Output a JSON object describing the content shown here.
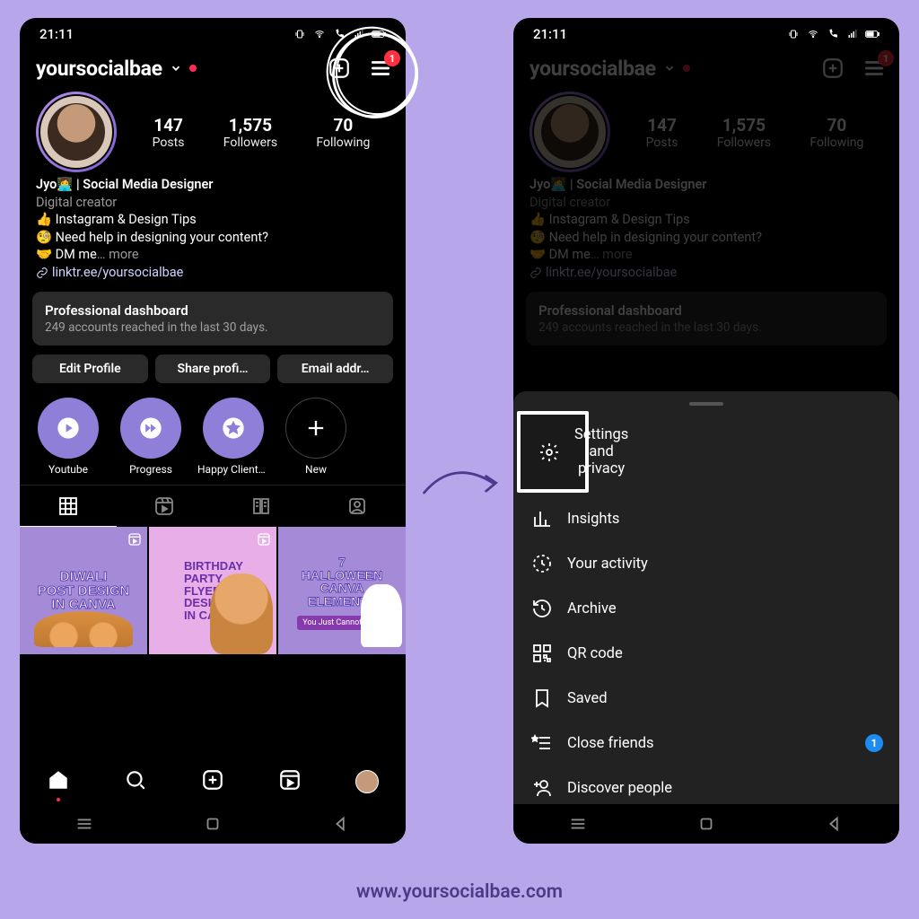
{
  "status": {
    "time": "21:11"
  },
  "header": {
    "username": "yoursocialbae",
    "menu_badge": "1"
  },
  "stats": {
    "posts": {
      "num": "147",
      "label": "Posts"
    },
    "followers": {
      "num": "1,575",
      "label": "Followers"
    },
    "following": {
      "num": "70",
      "label": "Following"
    }
  },
  "bio": {
    "name": "Jyo👩‍💻 | Social Media Designer",
    "category": "Digital creator",
    "line1": "👍 Instagram & Design Tips",
    "line2": "🧐 Need help in designing your content?",
    "line3_a": "🤝 DM me",
    "line3_more": "… more",
    "link": "linktr.ee/yoursocialbae"
  },
  "dashboard": {
    "title": "Professional dashboard",
    "sub": "249 accounts reached in the last 30 days."
  },
  "buttons": {
    "edit": "Edit Profile",
    "share": "Share profi…",
    "email": "Email addr…"
  },
  "highlights": [
    {
      "label": "Youtube"
    },
    {
      "label": "Progress"
    },
    {
      "label": "Happy Clients…"
    },
    {
      "label": "New"
    }
  ],
  "posts_grid": [
    {
      "title": "DIWALI\nPOST DESIGN\nIN CANVA"
    },
    {
      "title": "BIRTHDAY\nPARTY\nFLYER\nDESIGN\nIN CANVA"
    },
    {
      "title": "7\nHALLOWEEN\nCANVA\nELEMENTS",
      "sub": "You Just Cannot Miss"
    }
  ],
  "menu": {
    "settings": "Settings and privacy",
    "insights": "Insights",
    "activity": "Your activity",
    "archive": "Archive",
    "qr": "QR code",
    "saved": "Saved",
    "close_friends": "Close friends",
    "close_friends_badge": "1",
    "discover": "Discover people"
  },
  "footer_url": "www.yoursocialbae.com"
}
